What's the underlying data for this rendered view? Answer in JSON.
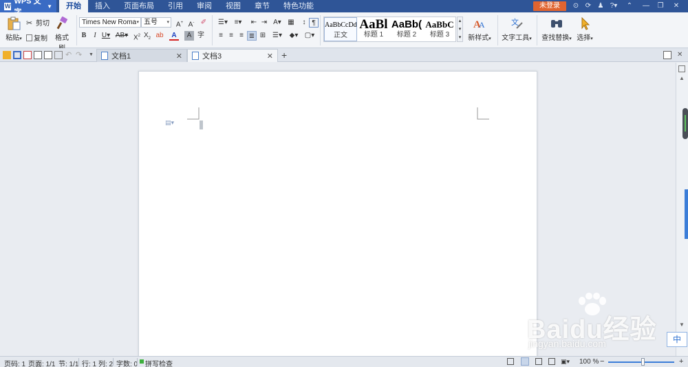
{
  "app": {
    "name": "WPS 文字"
  },
  "menu": {
    "tabs": [
      "开始",
      "插入",
      "页面布局",
      "引用",
      "审阅",
      "视图",
      "章节",
      "特色功能"
    ],
    "active_index": 0,
    "login_label": "未登录",
    "help_label": "?"
  },
  "ribbon": {
    "clipboard": {
      "paste": "粘贴",
      "cut": "剪切",
      "copy": "复制",
      "format_painter": "格式刷"
    },
    "font": {
      "family": "Times New Roma",
      "size": "五号"
    },
    "styles": {
      "items": [
        {
          "sample": "AaBbCcDd",
          "name": "正文"
        },
        {
          "sample": "AaBl",
          "name": "标题 1"
        },
        {
          "sample": "AaBb(",
          "name": "标题 2"
        },
        {
          "sample": "AaBbC",
          "name": "标题 3"
        }
      ],
      "new_style": "新样式"
    },
    "text_tools": "文字工具",
    "find_replace": "查找替换",
    "select": "选择"
  },
  "tabs": {
    "docs": [
      {
        "title": "文档1"
      },
      {
        "title": "文档3"
      }
    ],
    "active_index": 1,
    "add_label": "+"
  },
  "status": {
    "page_code": "页码: 1",
    "pages": "页面: 1/1",
    "section": "节: 1/1",
    "row": "行: 1",
    "col": "列: 2",
    "words": "字数: 0",
    "spell": "拼写检查",
    "zoom": "100 %",
    "zoom_minus": "−",
    "zoom_plus": "+"
  },
  "watermark": {
    "text": "Baidu经验",
    "url": "jingyan.baidu.com"
  },
  "ime": "中",
  "colors": {
    "title_bg": "#2f5597",
    "login": "#e06430",
    "accent": "#3b7dd8"
  }
}
